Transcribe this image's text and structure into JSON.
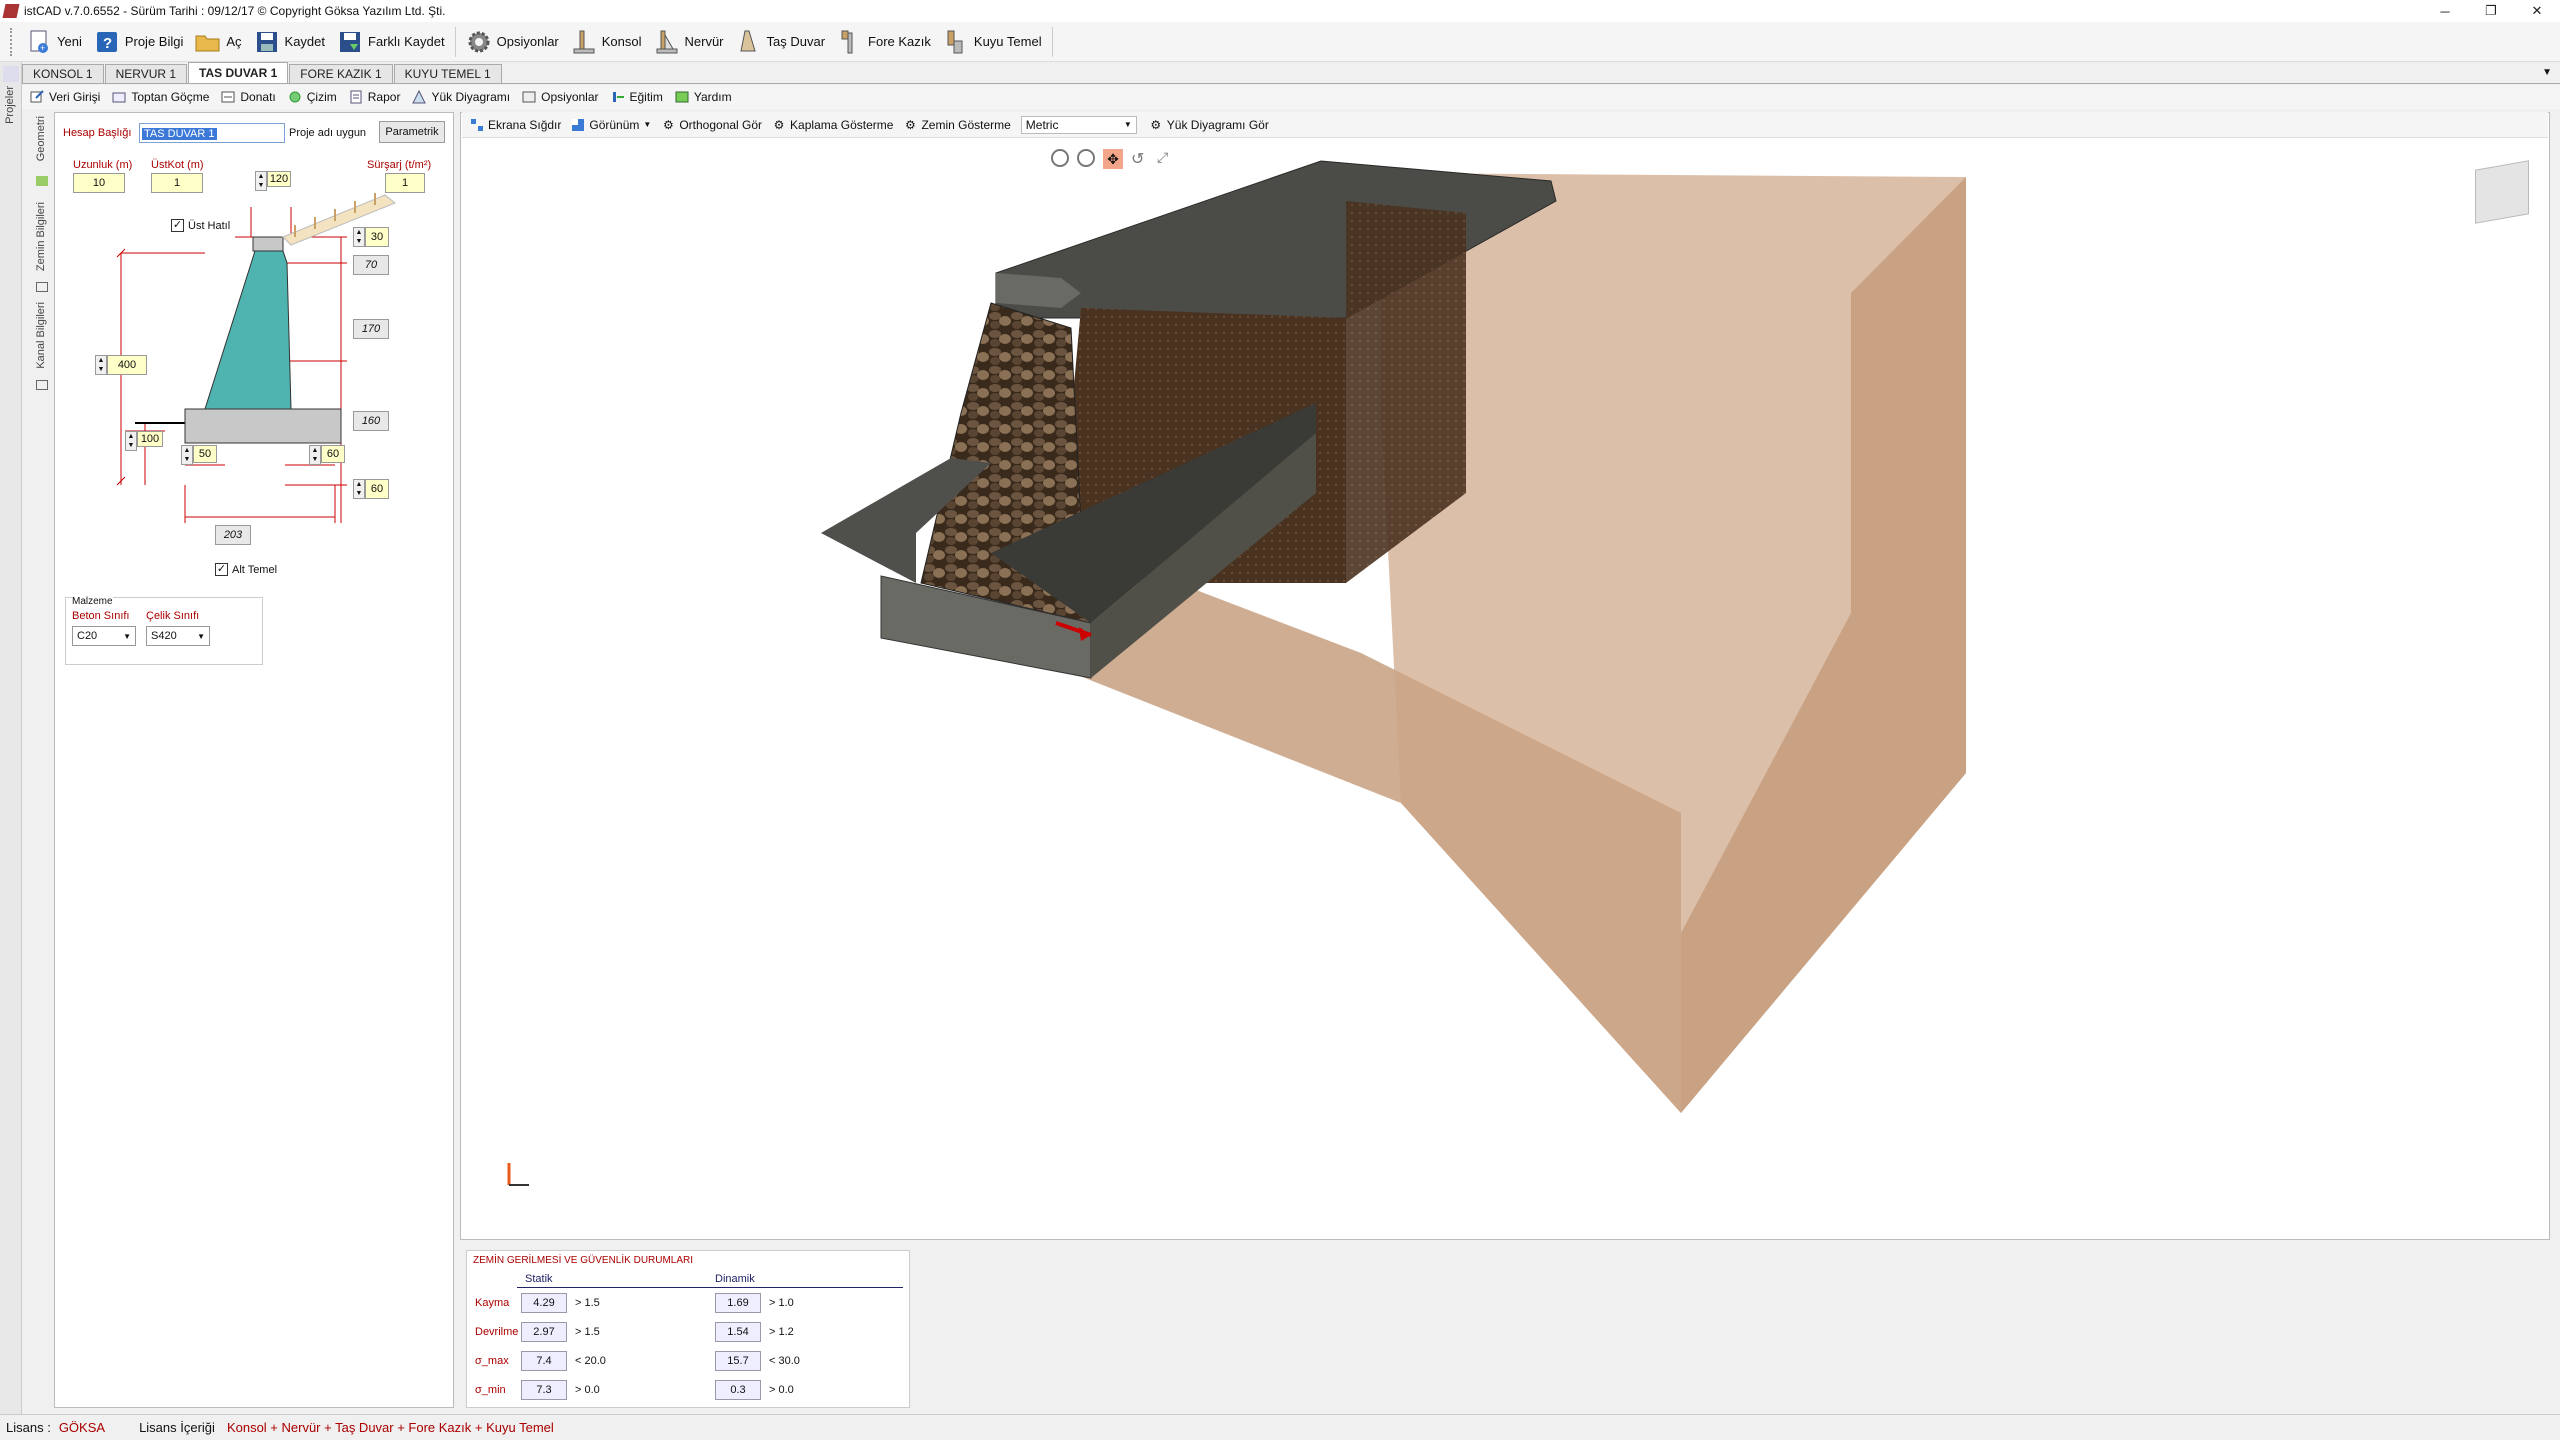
{
  "window": {
    "title": "istCAD v.7.0.6552 -  Sürüm Tarihi : 09/12/17  © Copyright Göksa Yazılım Ltd. Şti."
  },
  "toolbar": {
    "yeni": "Yeni",
    "proje_bilgi": "Proje Bilgi",
    "ac": "Aç",
    "kaydet": "Kaydet",
    "farkli_kaydet": "Farklı Kaydet",
    "opsiyonlar": "Opsiyonlar",
    "konsol": "Konsol",
    "nervur": "Nervür",
    "tas_duvar": "Taş Duvar",
    "fore_kazik": "Fore Kazık",
    "kuyu_temel": "Kuyu Temel"
  },
  "left_strip": {
    "label": "Projeler"
  },
  "tabs": [
    "KONSOL 1",
    "NERVUR 1",
    "TAS DUVAR 1",
    "FORE KAZIK 1",
    "KUYU TEMEL 1"
  ],
  "subbar": {
    "veri_girisi": "Veri Girişi",
    "toptan_gocme": "Toptan Göçme",
    "donati": "Donatı",
    "cizim": "Çizim",
    "rapor": "Rapor",
    "yuk_diyagrami": "Yük Diyagramı",
    "opsiyonlar": "Opsiyonlar",
    "egitim": "Eğitim",
    "yardim": "Yardım"
  },
  "side_tabs": [
    "Geometri",
    "Zemin Bilgileri",
    "Kanal Bilgileri"
  ],
  "form": {
    "hesap_basligi_label": "Hesap Başlığı",
    "hesap_basligi": "TAS DUVAR 1",
    "proje_adi": "Proje adı uygun",
    "parametrik": "Parametrik",
    "uzunluk_label": "Uzunluk (m)",
    "uzunluk": "10",
    "ustkot_label": "ÜstKot (m)",
    "ustkot": "1",
    "sursarj_label": "Sürşarj (t/m²)",
    "sursarj": "1",
    "dim_120": "120",
    "dim_30": "30",
    "dim_70": "70",
    "dim_170": "170",
    "dim_400": "400",
    "dim_160": "160",
    "dim_100": "100",
    "dim_50": "50",
    "dim_60a": "60",
    "dim_60b": "60",
    "dim_203": "203",
    "ust_hatil": "Üst Hatıl",
    "alt_temel": "Alt Temel",
    "malzeme": "Malzeme",
    "beton_label": "Beton Sınıfı",
    "beton": "C20",
    "celik_label": "Çelik Sınıfı",
    "celik": "S420"
  },
  "viewbar": {
    "ekrana_sigdir": "Ekrana Sığdır",
    "gorunum": "Görünüm",
    "orthogonal": "Orthogonal Gör",
    "kaplama": "Kaplama Gösterme",
    "zemin": "Zemin Gösterme",
    "units": "Metric",
    "yuk": "Yük Diyagramı Gör"
  },
  "results": {
    "title": "ZEMİN GERİLMESİ VE GÜVENLİK DURUMLARI",
    "statik": "Statik",
    "dinamik": "Dinamik",
    "rows": [
      {
        "name": "Kayma",
        "s": "4.29",
        "sc": "> 1.5",
        "d": "1.69",
        "dc": "> 1.0"
      },
      {
        "name": "Devrilme",
        "s": "2.97",
        "sc": "> 1.5",
        "d": "1.54",
        "dc": "> 1.2"
      },
      {
        "name": "σ_max",
        "s": "7.4",
        "sc": "< 20.0",
        "d": "15.7",
        "dc": "< 30.0"
      },
      {
        "name": "σ_min",
        "s": "7.3",
        "sc": "> 0.0",
        "d": "0.3",
        "dc": "> 0.0"
      }
    ]
  },
  "status": {
    "lisans_label": "Lisans :",
    "lisans": "GÖKSA",
    "icerik_label": "Lisans İçeriği",
    "icerik": "Konsol + Nervür + Taş Duvar + Fore Kazık + Kuyu Temel"
  },
  "colors": {
    "wall_fill": "#4fb3b0",
    "accent_red": "#a00000",
    "input_yellow": "#ffffc8",
    "soil": "#c9a58a",
    "concrete": "#5a5a55"
  }
}
